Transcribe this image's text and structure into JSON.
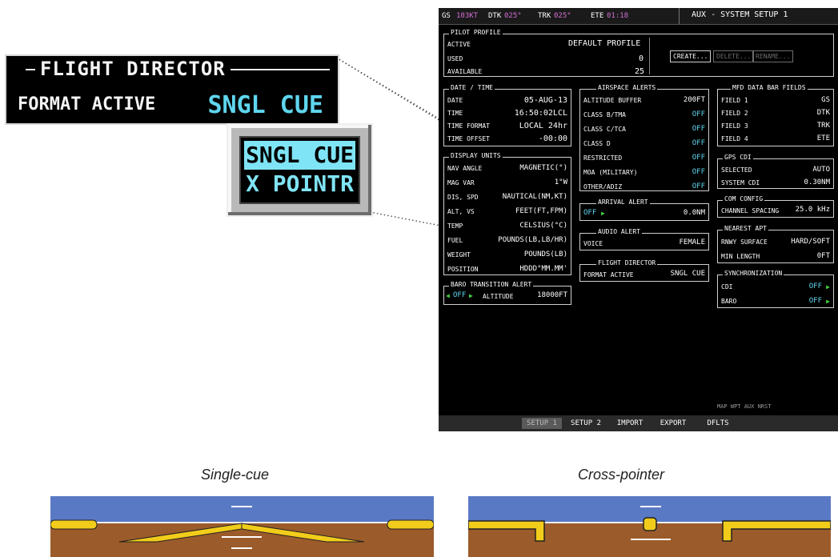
{
  "callout": {
    "title": "FLIGHT DIRECTOR",
    "format_label": "FORMAT ACTIVE",
    "format_value": "SNGL CUE",
    "options": [
      "SNGL CUE",
      "X POINTR"
    ]
  },
  "mfd": {
    "topbar": {
      "gs_label": "GS",
      "gs_value": "103KT",
      "dtk_label": "DTK",
      "dtk_value": "025°",
      "trk_label": "TRK",
      "trk_value": "025°",
      "ete_label": "ETE",
      "ete_value": "01:18",
      "page_title": "AUX - SYSTEM SETUP 1"
    },
    "pilot_profile": {
      "title": "PILOT PROFILE",
      "active_label": "ACTIVE",
      "active_value": "DEFAULT PROFILE",
      "used_label": "USED",
      "used_value": "0",
      "available_label": "AVAILABLE",
      "available_value": "25",
      "create": "CREATE...",
      "delete": "DELETE...",
      "rename": "RENAME..."
    },
    "date_time": {
      "title": "DATE / TIME",
      "rows": [
        {
          "label": "DATE",
          "value": "05-AUG-13"
        },
        {
          "label": "TIME",
          "value": "16:50:02LCL"
        },
        {
          "label": "TIME FORMAT",
          "value": "LOCAL 24hr"
        },
        {
          "label": "TIME OFFSET",
          "value": "-00:00"
        }
      ]
    },
    "display_units": {
      "title": "DISPLAY UNITS",
      "rows": [
        {
          "label": "NAV ANGLE",
          "value": "MAGNETIC(°)"
        },
        {
          "label": "MAG VAR",
          "value": "1°W"
        },
        {
          "label": "DIS, SPD",
          "value": "NAUTICAL(NM,KT)"
        },
        {
          "label": "ALT, VS",
          "value": "FEET(FT,FPM)"
        },
        {
          "label": "TEMP",
          "value": "CELSIUS(°C)"
        },
        {
          "label": "FUEL",
          "value": "POUNDS(LB,LB/HR)"
        },
        {
          "label": "WEIGHT",
          "value": "POUNDS(LB)"
        },
        {
          "label": "POSITION",
          "value": "HDDD°MM.MM'"
        }
      ]
    },
    "baro_transition": {
      "title": "BARO TRANSITION ALERT",
      "state": "OFF",
      "alt_label": "ALTITUDE",
      "alt_value": "18000FT"
    },
    "airspace_alerts": {
      "title": "AIRSPACE ALERTS",
      "rows": [
        {
          "label": "ALTITUDE BUFFER",
          "value": "200FT"
        },
        {
          "label": "CLASS B/TMA",
          "value": "OFF"
        },
        {
          "label": "CLASS C/TCA",
          "value": "OFF"
        },
        {
          "label": "CLASS D",
          "value": "OFF"
        },
        {
          "label": "RESTRICTED",
          "value": "OFF"
        },
        {
          "label": "MOA (MILITARY)",
          "value": "OFF"
        },
        {
          "label": "OTHER/ADIZ",
          "value": "OFF"
        }
      ]
    },
    "arrival_alert": {
      "title": "ARRIVAL ALERT",
      "state": "OFF",
      "value": "0.0NM"
    },
    "audio_alert": {
      "title": "AUDIO ALERT",
      "label": "VOICE",
      "value": "FEMALE"
    },
    "flight_director": {
      "title": "FLIGHT DIRECTOR",
      "label": "FORMAT ACTIVE",
      "value": "SNGL CUE"
    },
    "data_bar": {
      "title": "MFD DATA BAR FIELDS",
      "rows": [
        {
          "label": "FIELD 1",
          "value": "GS"
        },
        {
          "label": "FIELD 2",
          "value": "DTK"
        },
        {
          "label": "FIELD 3",
          "value": "TRK"
        },
        {
          "label": "FIELD 4",
          "value": "ETE"
        }
      ]
    },
    "gps_cdi": {
      "title": "GPS CDI",
      "selected_label": "SELECTED",
      "selected_value": "AUTO",
      "system_label": "SYSTEM CDI",
      "system_value": "0.30NM"
    },
    "com_config": {
      "title": "COM CONFIG",
      "label": "CHANNEL SPACING",
      "value": "25.0 kHz"
    },
    "nearest_apt": {
      "title": "NEAREST APT",
      "surface_label": "RNWY SURFACE",
      "surface_value": "HARD/SOFT",
      "min_label": "MIN LENGTH",
      "min_value": "0FT"
    },
    "synchronization": {
      "title": "SYNCHRONIZATION",
      "rows": [
        {
          "label": "CDI",
          "value": "OFF"
        },
        {
          "label": "BARO",
          "value": "OFF"
        }
      ]
    },
    "nav_strip": "MAP WPT AUX NRST",
    "softkeys": [
      "SETUP 1",
      "SETUP 2",
      "IMPORT",
      "EXPORT",
      "DFLTS"
    ]
  },
  "captions": {
    "single_cue": "Single-cue",
    "cross_pointer": "Cross-pointer"
  },
  "colors": {
    "cyan": "#5fd6ef",
    "magenta": "#d56fd6",
    "green": "#3fd23f",
    "sky": "#5a79c4",
    "ground": "#9b5b2a",
    "command_bar": "#f2cc1a"
  }
}
